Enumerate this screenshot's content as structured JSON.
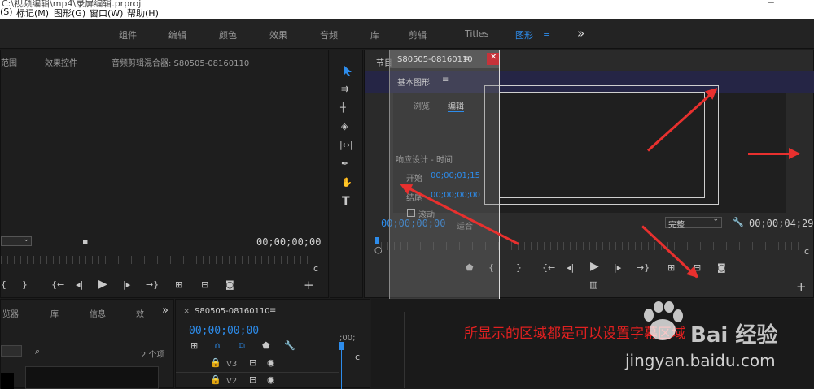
{
  "menubar": {
    "title_fragment": "C:\\视频编辑\\mp4\\录屏编辑.prproj",
    "items": [
      "(S)",
      "标记(M)",
      "图形(G)",
      "窗口(W)",
      "帮助(H)"
    ]
  },
  "workspace": {
    "tabs": [
      "组件",
      "编辑",
      "颜色",
      "效果",
      "音频",
      "库",
      "剪辑",
      "Titles",
      "图形"
    ],
    "menu_icon": "≡",
    "more_icon": "»"
  },
  "source_panel": {
    "tabs": [
      "范围",
      "效果控件",
      "音频剪辑混合器: S80505-08160110"
    ],
    "timecode": "00;00;00;00"
  },
  "tools": [
    "selection-tool",
    "track-select-tool",
    "ripple-edit-tool",
    "razor-tool",
    "slip-tool",
    "pen-tool",
    "hand-tool",
    "type-tool"
  ],
  "program_panel": {
    "tab": "节目",
    "timecode_left": "00;00;00;00",
    "fit_label": "适合",
    "quality": "完整",
    "timecode_right": "00;00;04;29"
  },
  "essential_graphics": {
    "title": "基本图形",
    "sequence": "S80505-08160110",
    "tabs": [
      "浏览",
      "编辑"
    ],
    "section": "响应设计 - 时间",
    "start_label": "开始",
    "start_value": "00;00;01;15",
    "end_label": "结尾",
    "end_value": "00;00;00;00",
    "roll_label": "滚动"
  },
  "project_panel": {
    "tabs": [
      "览器",
      "库",
      "信息",
      "效"
    ],
    "item_count": "2 个项"
  },
  "timeline": {
    "sequence": "S80505-08160110",
    "timecode": "00;00;00;00",
    "ruler_label": ";00;",
    "tracks": [
      "V3",
      "V2"
    ]
  },
  "annotation": {
    "caption": "所显示的区域都是可以设置字幕区域"
  },
  "watermark": {
    "text_logo": "Bai 经验",
    "url": "jingyan.baidu.com"
  },
  "colors": {
    "accent": "#2d8ceb",
    "arrow": "#e8302e",
    "caption": "#e02020"
  }
}
